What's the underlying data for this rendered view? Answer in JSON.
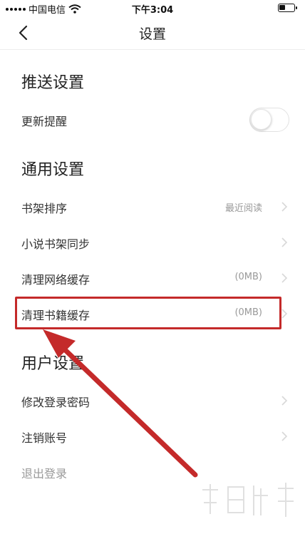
{
  "status_bar": {
    "carrier": "中国电信",
    "time": "下午3:04"
  },
  "nav": {
    "title": "设置"
  },
  "sections": {
    "push": {
      "title": "推送设置",
      "items": [
        {
          "label": "更新提醒",
          "toggle_on": false
        }
      ]
    },
    "general": {
      "title": "通用设置",
      "items": [
        {
          "label": "书架排序",
          "value": "最近阅读"
        },
        {
          "label": "小说书架同步",
          "value": ""
        },
        {
          "label": "清理网络缓存",
          "value": "(0MB)"
        },
        {
          "label": "清理书籍缓存",
          "value": "(0MB)"
        }
      ]
    },
    "user": {
      "title": "用户设置",
      "items": [
        {
          "label": "修改登录密码"
        },
        {
          "label": "注销账号"
        },
        {
          "label": "退出登录"
        }
      ]
    }
  },
  "colors": {
    "annotation_red": "#c42a2a",
    "muted_text": "#999999"
  },
  "icons": {
    "back": "chevron-left-icon",
    "row_arrow": "chevron-right-icon",
    "wifi": "wifi-icon",
    "battery": "battery-icon"
  }
}
